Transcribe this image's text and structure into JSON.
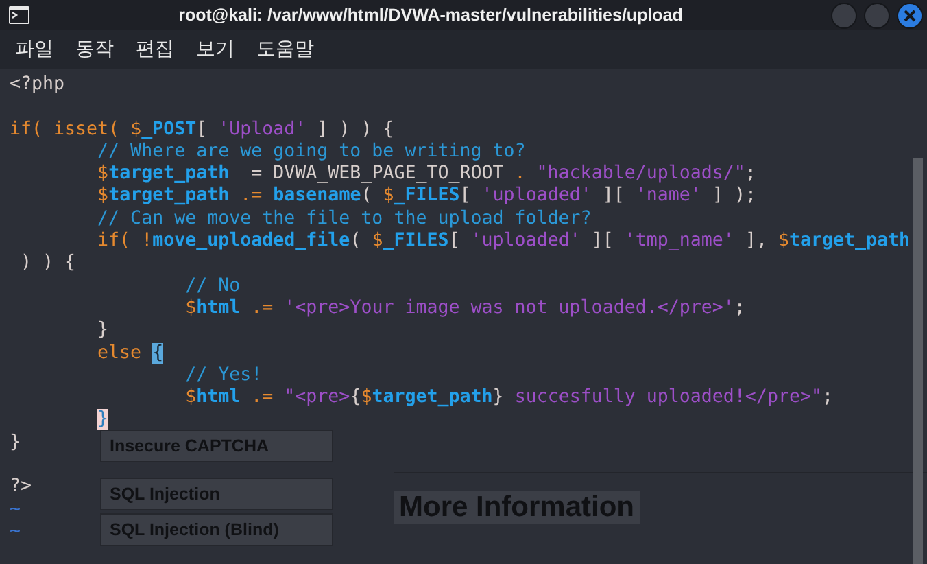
{
  "window": {
    "title": "root@kali: /var/www/html/DVWA-master/vulnerabilities/upload"
  },
  "menu": [
    "파일",
    "동작",
    "편집",
    "보기",
    "도움말"
  ],
  "background_page": {
    "sidebar_items": [
      "Insecure CAPTCHA",
      "SQL Injection",
      "SQL Injection (Blind)"
    ],
    "heading": "More Information"
  },
  "lines": [
    {
      "kind": "code",
      "tokens": [
        {
          "text": "<?php",
          "kind": "plain"
        }
      ]
    },
    {
      "kind": "blank"
    },
    {
      "kind": "code",
      "tokens": [
        {
          "text": "if( isset( ",
          "kind": "keyword"
        },
        {
          "text": "$",
          "kind": "sigil"
        },
        {
          "text": "_POST",
          "kind": "var"
        },
        {
          "text": "[ ",
          "kind": "plain"
        },
        {
          "text": "'Upload'",
          "kind": "string"
        },
        {
          "text": " ] ) ) {",
          "kind": "plain"
        }
      ]
    },
    {
      "kind": "code",
      "tokens": [
        {
          "text": "        // Where are we going to be writing to?",
          "kind": "comment"
        }
      ]
    },
    {
      "kind": "code",
      "tokens": [
        {
          "text": "        $",
          "kind": "sigil"
        },
        {
          "text": "target_path",
          "kind": "var"
        },
        {
          "text": "  = DVWA_WEB_PAGE_TO_ROOT ",
          "kind": "plain"
        },
        {
          "text": ".",
          "kind": "sigil"
        },
        {
          "text": " \"hackable/uploads/\"",
          "kind": "string"
        },
        {
          "text": ";",
          "kind": "plain"
        }
      ]
    },
    {
      "kind": "code",
      "tokens": [
        {
          "text": "        $",
          "kind": "sigil"
        },
        {
          "text": "target_path",
          "kind": "var"
        },
        {
          "text": " .= ",
          "kind": "sigil"
        },
        {
          "text": "basename",
          "kind": "func"
        },
        {
          "text": "( ",
          "kind": "plain"
        },
        {
          "text": "$",
          "kind": "sigil"
        },
        {
          "text": "_FILES",
          "kind": "var"
        },
        {
          "text": "[ ",
          "kind": "plain"
        },
        {
          "text": "'uploaded'",
          "kind": "string"
        },
        {
          "text": " ][ ",
          "kind": "plain"
        },
        {
          "text": "'name'",
          "kind": "string"
        },
        {
          "text": " ] );",
          "kind": "plain"
        }
      ]
    },
    {
      "kind": "code",
      "tokens": [
        {
          "text": "        // Can we move the file to the upload folder?",
          "kind": "comment"
        }
      ]
    },
    {
      "kind": "code",
      "tokens": [
        {
          "text": "        if( !",
          "kind": "keyword"
        },
        {
          "text": "move_uploaded_file",
          "kind": "func"
        },
        {
          "text": "( ",
          "kind": "plain"
        },
        {
          "text": "$",
          "kind": "sigil"
        },
        {
          "text": "_FILES",
          "kind": "var"
        },
        {
          "text": "[ ",
          "kind": "plain"
        },
        {
          "text": "'uploaded'",
          "kind": "string"
        },
        {
          "text": " ][ ",
          "kind": "plain"
        },
        {
          "text": "'tmp_name'",
          "kind": "string"
        },
        {
          "text": " ], ",
          "kind": "plain"
        },
        {
          "text": "$",
          "kind": "sigil"
        },
        {
          "text": "target_path",
          "kind": "var"
        }
      ]
    },
    {
      "kind": "code",
      "tokens": [
        {
          "text": " ) ) {",
          "kind": "plain"
        }
      ]
    },
    {
      "kind": "code",
      "tokens": [
        {
          "text": "                // No",
          "kind": "comment"
        }
      ]
    },
    {
      "kind": "code",
      "tokens": [
        {
          "text": "                $",
          "kind": "sigil"
        },
        {
          "text": "html",
          "kind": "var"
        },
        {
          "text": " .= ",
          "kind": "sigil"
        },
        {
          "text": "'<pre>Your image was not uploaded.</pre>'",
          "kind": "string"
        },
        {
          "text": ";",
          "kind": "plain"
        }
      ]
    },
    {
      "kind": "code",
      "tokens": [
        {
          "text": "        }",
          "kind": "plain"
        }
      ]
    },
    {
      "kind": "code",
      "tokens": [
        {
          "text": "        else ",
          "kind": "keyword"
        },
        {
          "text": "{",
          "kind": "match"
        }
      ]
    },
    {
      "kind": "code",
      "tokens": [
        {
          "text": "                // Yes!",
          "kind": "comment"
        }
      ]
    },
    {
      "kind": "code",
      "tokens": [
        {
          "text": "                $",
          "kind": "sigil"
        },
        {
          "text": "html",
          "kind": "var"
        },
        {
          "text": " .= ",
          "kind": "sigil"
        },
        {
          "text": "\"<pre>",
          "kind": "string"
        },
        {
          "text": "{",
          "kind": "plain"
        },
        {
          "text": "$",
          "kind": "sigil"
        },
        {
          "text": "target_path",
          "kind": "var"
        },
        {
          "text": "}",
          "kind": "plain"
        },
        {
          "text": " succesfully uploaded!</pre>\"",
          "kind": "string"
        },
        {
          "text": ";",
          "kind": "plain"
        }
      ]
    },
    {
      "kind": "code",
      "tokens": [
        {
          "text": "        }",
          "kind": "cursor"
        }
      ]
    },
    {
      "kind": "code",
      "tokens": [
        {
          "text": "}",
          "kind": "plain"
        }
      ]
    },
    {
      "kind": "blank"
    },
    {
      "kind": "code",
      "tokens": [
        {
          "text": "?>",
          "kind": "plain"
        }
      ]
    },
    {
      "kind": "tilde",
      "text": "~"
    },
    {
      "kind": "tilde",
      "text": "~"
    }
  ]
}
